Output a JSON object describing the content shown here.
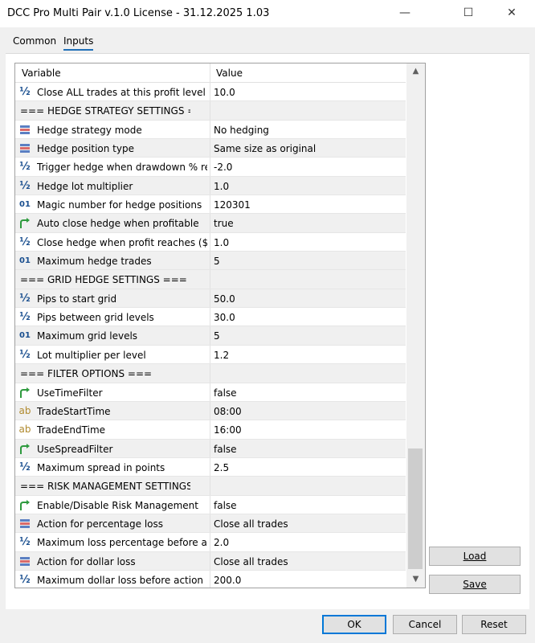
{
  "window": {
    "title": "DCC Pro Multi Pair v.1.0 License - 31.12.2025 1.03",
    "minimize": "—",
    "maximize": "☐",
    "close": "✕"
  },
  "tabs": [
    {
      "label": "Common"
    },
    {
      "label": "Inputs"
    }
  ],
  "grid": {
    "columns": {
      "variable": "Variable",
      "value": "Value"
    },
    "rows": [
      {
        "icon": "half",
        "name": "Close ALL trades at this profit level",
        "value": "10.0"
      },
      {
        "icon": "none",
        "name": "=== HEDGE STRATEGY SETTINGS ===",
        "value": ""
      },
      {
        "icon": "enum",
        "name": "Hedge strategy mode",
        "value": "No hedging"
      },
      {
        "icon": "enum",
        "name": "Hedge position type",
        "value": "Same size as original"
      },
      {
        "icon": "half",
        "name": "Trigger hedge when drawdown % re...",
        "value": "-2.0"
      },
      {
        "icon": "half",
        "name": "Hedge lot multiplier",
        "value": "1.0"
      },
      {
        "icon": "int",
        "name": "Magic number for hedge positions",
        "value": "120301"
      },
      {
        "icon": "bool",
        "name": "Auto close hedge when profitable",
        "value": "true"
      },
      {
        "icon": "half",
        "name": "Close hedge when profit reaches ($)",
        "value": "1.0"
      },
      {
        "icon": "int",
        "name": "Maximum hedge trades",
        "value": "5"
      },
      {
        "icon": "none",
        "name": "=== GRID HEDGE SETTINGS ===",
        "value": ""
      },
      {
        "icon": "half",
        "name": "Pips to start grid",
        "value": "50.0"
      },
      {
        "icon": "half",
        "name": "Pips between grid levels",
        "value": "30.0"
      },
      {
        "icon": "int",
        "name": "Maximum grid levels",
        "value": "5"
      },
      {
        "icon": "half",
        "name": "Lot multiplier per level",
        "value": "1.2"
      },
      {
        "icon": "none",
        "name": "=== FILTER OPTIONS ===",
        "value": ""
      },
      {
        "icon": "bool",
        "name": "UseTimeFilter",
        "value": "false"
      },
      {
        "icon": "ab",
        "name": "TradeStartTime",
        "value": "08:00"
      },
      {
        "icon": "ab",
        "name": "TradeEndTime",
        "value": "16:00"
      },
      {
        "icon": "bool",
        "name": "UseSpreadFilter",
        "value": "false"
      },
      {
        "icon": "half",
        "name": "Maximum spread in points",
        "value": "2.5"
      },
      {
        "icon": "none",
        "name": "=== RISK MANAGEMENT SETTINGS ===",
        "value": ""
      },
      {
        "icon": "bool",
        "name": "Enable/Disable Risk Management",
        "value": "false"
      },
      {
        "icon": "enum",
        "name": "Action for percentage loss",
        "value": "Close all trades"
      },
      {
        "icon": "half",
        "name": "Maximum loss percentage before acti...",
        "value": "2.0"
      },
      {
        "icon": "enum",
        "name": "Action for dollar loss",
        "value": "Close all trades"
      },
      {
        "icon": "half",
        "name": "Maximum dollar loss before action",
        "value": "200.0"
      }
    ]
  },
  "side_buttons": {
    "load": "Load",
    "save": "Save"
  },
  "footer": {
    "ok": "OK",
    "cancel": "Cancel",
    "reset": "Reset"
  },
  "colors": {
    "accent": "#1e6fb8",
    "half_icon": "#1a4f8f",
    "bool_icon": "#2e9a3e",
    "ab_icon": "#b08a2e"
  }
}
